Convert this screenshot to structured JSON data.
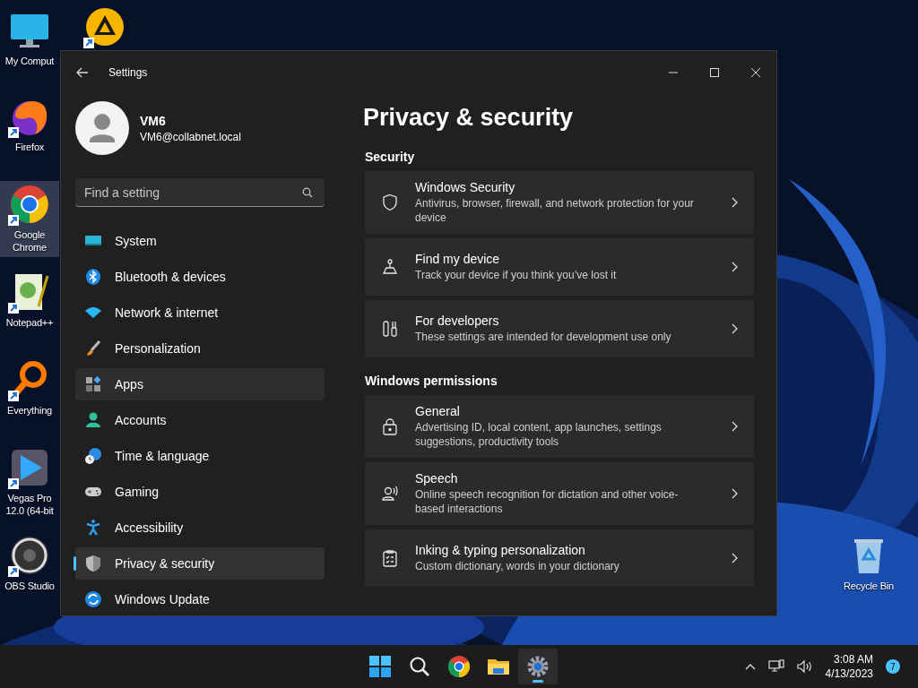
{
  "desktop_icons": [
    {
      "label": "My Comput",
      "shortcut": false,
      "selected": false
    },
    {
      "shortcut": true,
      "selected": false
    },
    {
      "label": "Firefox",
      "shortcut": true,
      "selected": false
    },
    {
      "label": "Google Chrome",
      "shortcut": true,
      "selected": true
    },
    {
      "label": "Notepad++",
      "shortcut": true,
      "selected": false
    },
    {
      "label": "Everything",
      "shortcut": true,
      "selected": false
    },
    {
      "label": "Vegas Pro 12.0 (64-bit",
      "shortcut": true,
      "selected": false
    },
    {
      "label": "OBS Studio",
      "shortcut": true,
      "selected": false
    },
    {
      "label": "Recycle Bin",
      "shortcut": false,
      "selected": false
    }
  ],
  "window": {
    "title": "Settings",
    "profile": {
      "name": "VM6",
      "email": "VM6@collabnet.local"
    },
    "search": {
      "placeholder": "Find a setting"
    },
    "nav": [
      {
        "label": "System",
        "selected": false,
        "hovered": false
      },
      {
        "label": "Bluetooth & devices",
        "selected": false,
        "hovered": false
      },
      {
        "label": "Network & internet",
        "selected": false,
        "hovered": false
      },
      {
        "label": "Personalization",
        "selected": false,
        "hovered": false
      },
      {
        "label": "Apps",
        "selected": false,
        "hovered": true
      },
      {
        "label": "Accounts",
        "selected": false,
        "hovered": false
      },
      {
        "label": "Time & language",
        "selected": false,
        "hovered": false
      },
      {
        "label": "Gaming",
        "selected": false,
        "hovered": false
      },
      {
        "label": "Accessibility",
        "selected": false,
        "hovered": false
      },
      {
        "label": "Privacy & security",
        "selected": true,
        "hovered": false
      },
      {
        "label": "Windows Update",
        "selected": false,
        "hovered": false
      }
    ],
    "page_title": "Privacy & security",
    "sections": [
      {
        "heading": "Security",
        "items": [
          {
            "title": "Windows Security",
            "description": "Antivirus, browser, firewall, and network protection for your device"
          },
          {
            "title": "Find my device",
            "description": "Track your device if you think you’ve lost it"
          },
          {
            "title": "For developers",
            "description": "These settings are intended for development use only"
          }
        ]
      },
      {
        "heading": "Windows permissions",
        "items": [
          {
            "title": "General",
            "description": "Advertising ID, local content, app launches, settings suggestions, productivity tools"
          },
          {
            "title": "Speech",
            "description": "Online speech recognition for dictation and other voice-based interactions"
          },
          {
            "title": "Inking & typing personalization",
            "description": "Custom dictionary, words in your dictionary"
          }
        ]
      }
    ]
  },
  "taskbar": {
    "apps": [
      {
        "selected": false
      },
      {
        "selected": false
      },
      {
        "selected": false
      },
      {
        "selected": false
      },
      {
        "selected": true
      }
    ],
    "time": "3:08 AM",
    "date": "4/13/2023",
    "notifications": "7"
  }
}
